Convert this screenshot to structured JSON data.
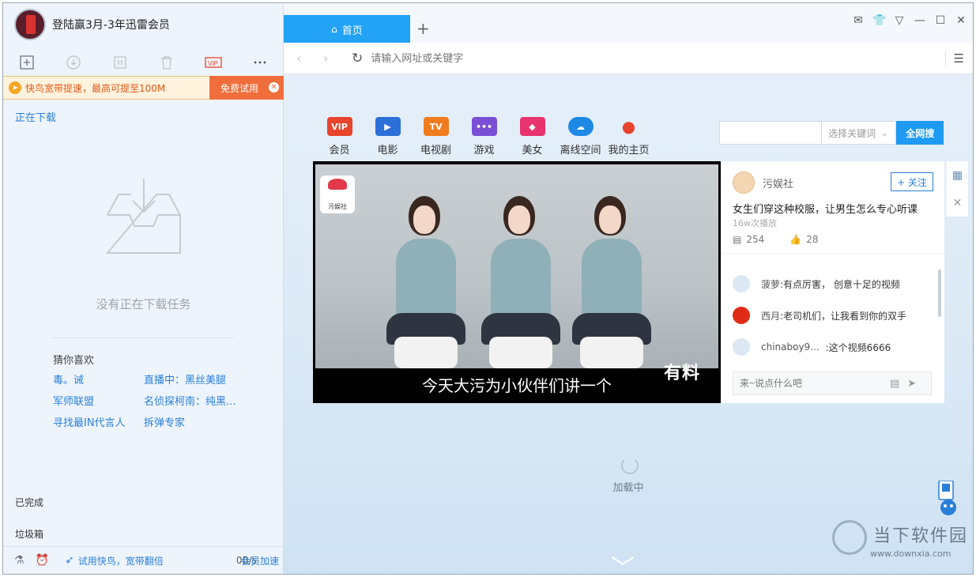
{
  "left": {
    "user_name": "登陆赢3月-3年迅雷会员",
    "toolbar": [
      "new-icon",
      "download-icon",
      "pause-icon",
      "delete-icon",
      "vip-icon",
      "more-icon"
    ],
    "promo": {
      "text": "快鸟宽带提速，最高可提至100M",
      "button": "免费试用"
    },
    "nav_downloading": "正在下载",
    "empty_text": "没有正在下载任务",
    "guess": {
      "title": "猜你喜欢",
      "items": [
        "毒。诫",
        "直播中：黑丝美腿",
        "军师联盟",
        "名侦探柯南：纯黑...",
        "寻找最IN代言人",
        "拆弹专家"
      ]
    },
    "nav_done": "已完成",
    "nav_trash": "垃圾箱",
    "status": {
      "promo": "试用快鸟，宽带翻倍",
      "speed": "0B/s",
      "vip": "会员加速"
    }
  },
  "browser": {
    "tab_label": "首页",
    "address_placeholder": "请输入网址或关键字",
    "categories": [
      {
        "label": "会员",
        "icon": "VIP",
        "color": "#e8432d"
      },
      {
        "label": "电影",
        "icon": "▶",
        "color": "#2b6fd8"
      },
      {
        "label": "电视剧",
        "icon": "TV",
        "color": "#f07c1e"
      },
      {
        "label": "游戏",
        "icon": "•••",
        "color": "#7a4fd6"
      },
      {
        "label": "美女",
        "icon": "◆",
        "color": "#e8336e"
      },
      {
        "label": "离线空间",
        "icon": "☁",
        "color": "#1e88e5"
      },
      {
        "label": "我的主页",
        "icon": "●",
        "color": "#e8432d"
      }
    ],
    "search": {
      "select_label": "选择关键词",
      "button": "全网搜"
    },
    "video": {
      "subtitle": "今天大污为小伙伴们讲一个",
      "watermark": "有料",
      "logo": "污娱社"
    },
    "info": {
      "channel": "污娱社",
      "follow": "+ 关注",
      "title": "女生们穿这种校服，让男生怎么专心听课",
      "plays": "16w次播放",
      "comments_count": "254",
      "likes": "28",
      "comments": [
        {
          "user": "菠萝",
          "text": ":有点厉害，  创意十足的视频",
          "avatar_color": "#dbe8f3"
        },
        {
          "user": "西月",
          "text": ":老司机们，让我看到你的双手",
          "avatar_color": "#e02b16"
        },
        {
          "user": "chinaboy9...",
          "text": ":这个视频6666",
          "avatar_color": "#dbe8f3"
        }
      ],
      "comment_placeholder": "来~说点什么吧"
    },
    "loading_text": "加载中",
    "brand": {
      "name": "当下软件园",
      "url": "www.downxia.com"
    }
  }
}
